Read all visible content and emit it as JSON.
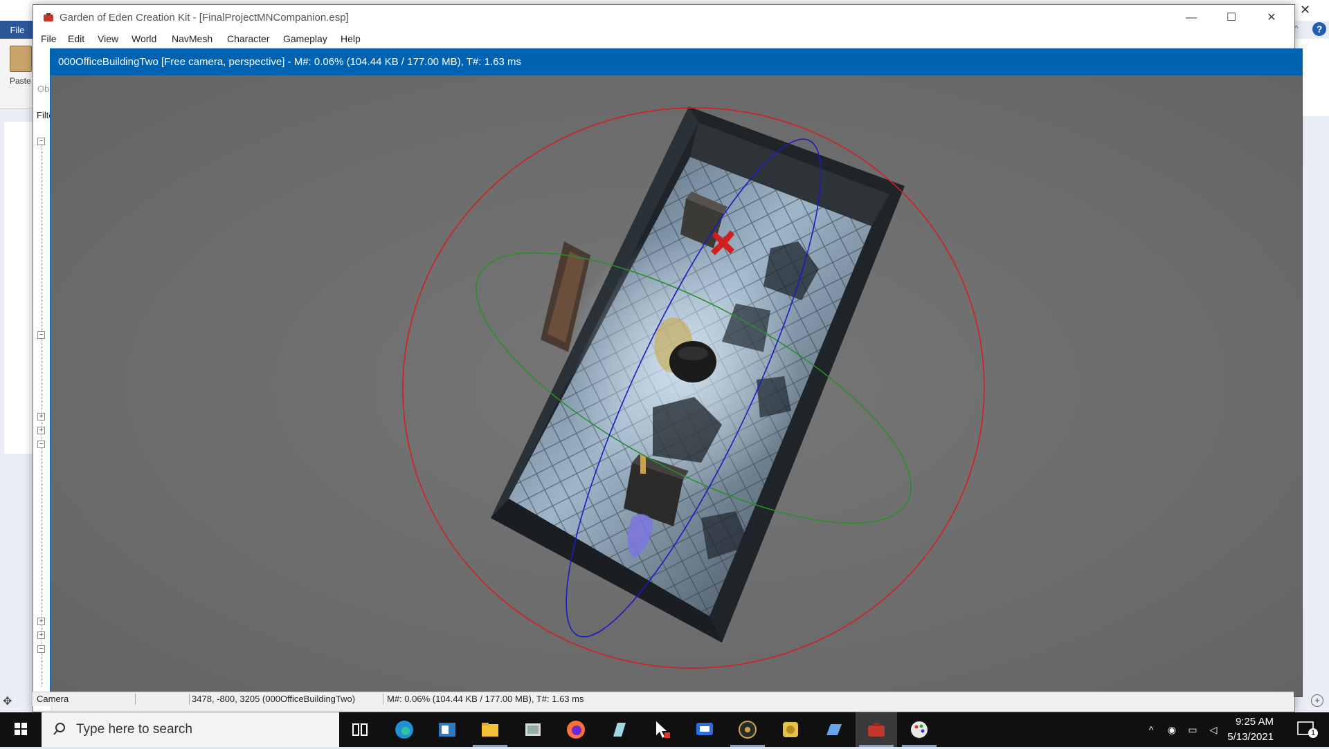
{
  "background_app": {
    "ribbon_tab": "File",
    "paste_label": "Paste",
    "close_glyph": "✕",
    "help_glyph": "?"
  },
  "ck": {
    "title": "Garden of Eden Creation Kit - [FinalProjectMNCompanion.esp]",
    "menu": [
      "File",
      "Edit",
      "View",
      "World",
      "NavMesh",
      "Character",
      "Gameplay",
      "Help"
    ],
    "left_panel": {
      "object_label": "Ob",
      "filter_label": "Filte"
    }
  },
  "render_window": {
    "title": "000OfficeBuildingTwo [Free camera, perspective] - M#: 0.06% (104.44 KB / 177.00 MB), T#: 1.63 ms"
  },
  "statusbar": {
    "cells": [
      "Camera",
      "",
      "3478, -800, 3205 (000OfficeBuildingTwo)",
      "M#: 0.06% (104.44 KB / 177.00 MB), T#: 1.63 ms"
    ]
  },
  "taskbar": {
    "search_placeholder": "Type here to search",
    "apps": [
      "task-view-icon",
      "edge-icon",
      "outlook-icon",
      "file-explorer-icon",
      "snipping-icon",
      "firefox-icon",
      "notepad-icon",
      "cursor-tool-icon",
      "remote-desktop-icon",
      "fallout-icon",
      "sticky-icon",
      "writer-icon",
      "geck-icon",
      "paint-icon"
    ],
    "time": "9:25 AM",
    "date": "5/13/2021",
    "notification_count": "1"
  }
}
